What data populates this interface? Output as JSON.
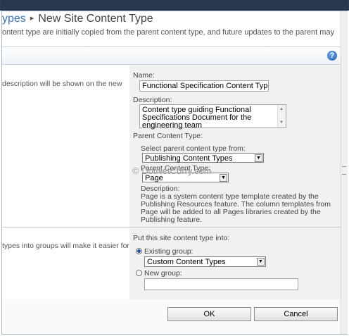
{
  "header": {
    "breadcrumb_prev": "ypes",
    "separator": "▸",
    "title": "New Site Content Type",
    "subtitle": "ontent type are initially copied from the parent content type, and future updates to the parent may"
  },
  "help_icon": "?",
  "name_section": {
    "left_text": "description will be shown on the new",
    "name_label": "Name:",
    "name_value": "Functional Specification Content Type",
    "description_label": "Description:",
    "description_value": "Content type guiding Functional Specifications Document for the engineering team",
    "parent_label": "Parent Content Type:",
    "select_from_label": "Select parent content type from:",
    "select_from_value": "Publishing Content Types",
    "parent_type_label": "Parent Content Type:",
    "parent_type_value": "Page",
    "desc_heading": "Description:",
    "desc_text": "Page is a system content type template created by the Publishing Resources feature. The column templates from Page will be added to all Pages libraries created by the Publishing feature."
  },
  "watermark": "© DotNetCurry.com",
  "group_section": {
    "left_text": "types into groups will make it easier for",
    "put_label": "Put this site content type into:",
    "existing_label": "Existing group:",
    "existing_value": "Custom Content Types",
    "new_label": "New group:",
    "new_value": ""
  },
  "buttons": {
    "ok": "OK",
    "cancel": "Cancel"
  },
  "colors": {
    "accent": "#3b73b9",
    "topbar": "#27384c"
  }
}
